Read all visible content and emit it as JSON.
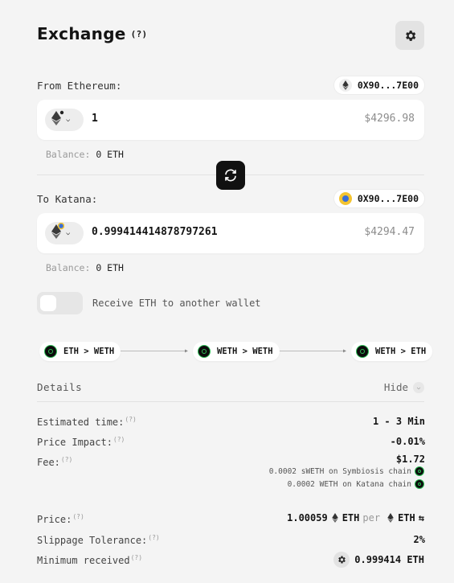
{
  "header": {
    "title": "Exchange",
    "help": "(?)"
  },
  "from": {
    "label": "From Ethereum:",
    "address": "0X90...7E00",
    "amount": "1",
    "usd": "$4296.98",
    "balance_label": "Balance:",
    "balance_value": "0 ETH"
  },
  "to": {
    "label": "To Katana:",
    "address": "0X90...7E00",
    "amount": "0.9994144148787 97261",
    "amount_full": "0.999414414878797261",
    "usd": "$4294.47",
    "balance_label": "Balance:",
    "balance_value": "0 ETH"
  },
  "toggle": {
    "label": "Receive ETH to another wallet",
    "on": false
  },
  "route": [
    {
      "label": "ETH > WETH"
    },
    {
      "label": "WETH > WETH"
    },
    {
      "label": "WETH > ETH"
    }
  ],
  "details": {
    "title": "Details",
    "hide_label": "Hide",
    "estimated_time_label": "Estimated time:",
    "estimated_time_value": "1 - 3 Min",
    "price_impact_label": "Price Impact:",
    "price_impact_value": "-0.01%",
    "fee_label": "Fee:",
    "fee_value": "$1.72",
    "fee_line1": "0.0002 sWETH on Symbiosis chain",
    "fee_line2": "0.0002 WETH on Katana chain",
    "price_label": "Price:",
    "price_value": "1.00059",
    "price_token1": "ETH",
    "price_per": "per",
    "price_token2": "ETH",
    "slippage_label": "Slippage Tolerance:",
    "slippage_value": "2%",
    "min_received_label": "Minimum received",
    "min_received_value": "0.999414 ETH",
    "help": "(?)"
  },
  "colors": {
    "accent_dark": "#111111",
    "katana_green": "#2dbd55",
    "background": "#f4f4f4"
  }
}
